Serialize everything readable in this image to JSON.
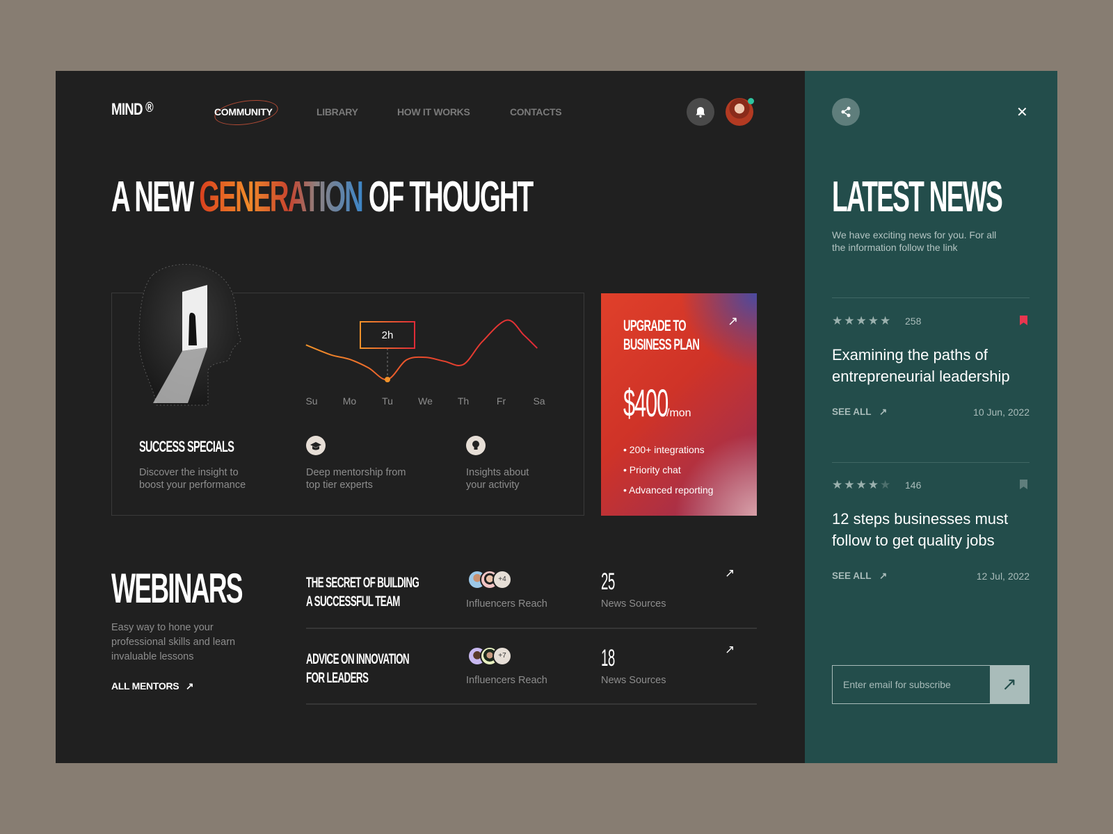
{
  "header": {
    "logo": "MIND",
    "logo_mark": "®",
    "nav": [
      {
        "label": "COMMUNITY",
        "active": true
      },
      {
        "label": "LIBRARY"
      },
      {
        "label": "HOW IT WORKS"
      },
      {
        "label": "CONTACTS"
      }
    ],
    "notification_icon": "bell-icon",
    "online_status_color": "#2ec4a0"
  },
  "hero": {
    "title_pre": "A NEW ",
    "title_highlight": "GENERATION",
    "title_post": " OF THOUGHT"
  },
  "stats_card": {
    "title": "SUCCESS SPECIALS",
    "description": "Discover the insight to boost your performance",
    "chart": {
      "days": [
        "Su",
        "Mo",
        "Tu",
        "We",
        "Th",
        "Fr",
        "Sa"
      ],
      "tooltip": "2h",
      "selected_day": "Tu",
      "activity_curve": [
        [
          -0.15,
          0.55
        ],
        [
          0.5,
          0.4
        ],
        [
          1,
          0.33
        ],
        [
          1.5,
          0.2
        ],
        [
          2,
          0.02
        ],
        [
          2.5,
          0.32
        ],
        [
          3,
          0.36
        ],
        [
          3.5,
          0.3
        ],
        [
          4,
          0.25
        ],
        [
          4.5,
          0.6
        ],
        [
          5.15,
          0.93
        ],
        [
          5.6,
          0.7
        ],
        [
          5.95,
          0.5
        ]
      ]
    },
    "features": [
      {
        "icon": "graduation-cap-icon",
        "text": "Deep mentorship from top tier experts"
      },
      {
        "icon": "lightbulb-icon",
        "text": "Insights about your activity"
      }
    ]
  },
  "upgrade": {
    "title_line1": "UPGRADE TO",
    "title_line2": "BUSINESS PLAN",
    "price": "$400",
    "period": "/mon",
    "features": [
      "200+ integrations",
      "Priority chat",
      "Advanced reporting"
    ]
  },
  "webinars": {
    "title": "WEBINARS",
    "description": "Easy way to hone your professional skills and learn invaluable lessons",
    "all_mentors": "ALL MENTORS",
    "items": [
      {
        "title_line1": "THE SECRET OF BUILDING",
        "title_line2": "A SUCCESSFUL TEAM",
        "extra": "+4",
        "reach_label": "Influencers Reach",
        "sources": "25",
        "sources_label": "News Sources"
      },
      {
        "title_line1": "ADVICE ON INNOVATION",
        "title_line2": "FOR LEADERS",
        "extra": "+7",
        "reach_label": "Influencers Reach",
        "sources": "18",
        "sources_label": "News Sources"
      }
    ]
  },
  "news": {
    "title": "LATEST NEWS",
    "description": "We have exciting news for you. For all the information follow the link",
    "items": [
      {
        "rating": 5,
        "count": "258",
        "title": "Examining the paths of entrepreneurial leadership",
        "see_all": "SEE ALL",
        "date": "10 Jun, 2022",
        "bookmarked": true
      },
      {
        "rating": 4,
        "count": "146",
        "title": "12 steps businesses must follow to get quality jobs",
        "see_all": "SEE ALL",
        "date": "12 Jul, 2022",
        "bookmarked": false
      }
    ],
    "subscribe_placeholder": "Enter email for subscribe"
  },
  "colors": {
    "dark_bg": "#202020",
    "teal_bg": "#234d4b",
    "accent_red": "#e8364f",
    "page_bg": "#877d72"
  }
}
